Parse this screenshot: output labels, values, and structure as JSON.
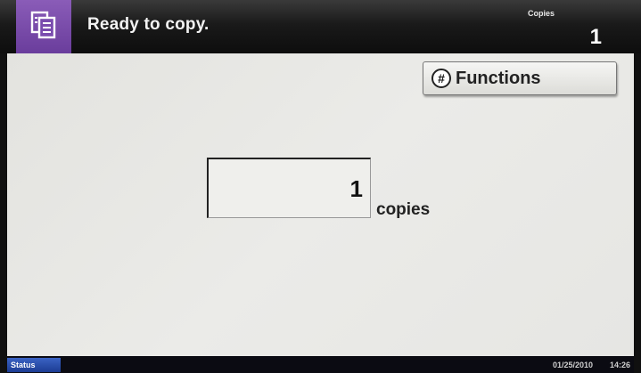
{
  "header": {
    "title": "Ready to copy.",
    "icon": "copy-document-icon",
    "tile_color": "#7a4cae",
    "copies_label": "Copies",
    "copies_count": "1"
  },
  "main": {
    "functions_button": {
      "icon": "hash-icon",
      "icon_glyph": "#",
      "label": "Functions"
    },
    "copy_count": {
      "value": "1",
      "unit": "copies"
    }
  },
  "statusbar": {
    "status_label": "Status",
    "date": "01/25/2010",
    "time": "14:26"
  }
}
